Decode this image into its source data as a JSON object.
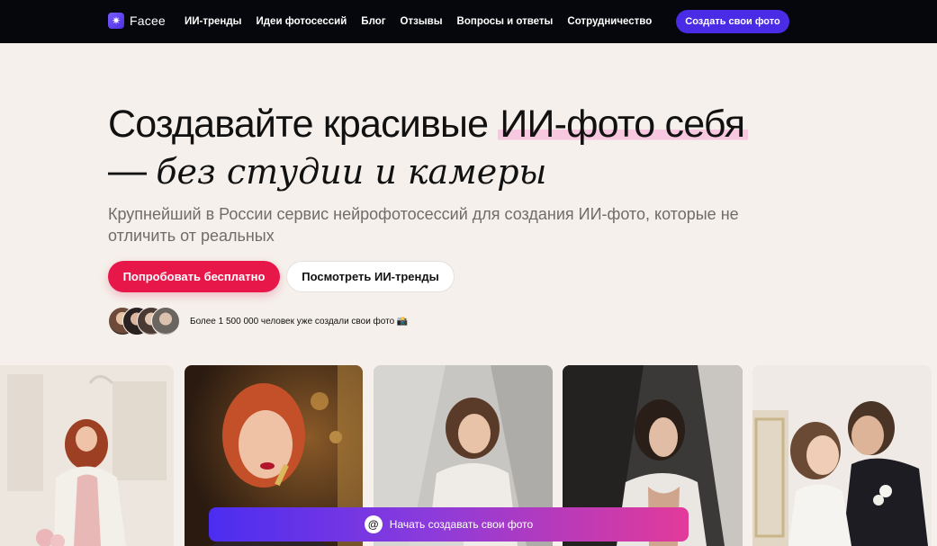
{
  "nav": {
    "logo": "Facee",
    "logo_icon": "sparkle-icon",
    "items": [
      {
        "label": "ИИ-тренды"
      },
      {
        "label": "Идеи фотосессий"
      },
      {
        "label": "Блог"
      },
      {
        "label": "Отзывы"
      },
      {
        "label": "Вопросы и ответы"
      },
      {
        "label": "Сотрудничество"
      }
    ],
    "cta": "Создать свои фото"
  },
  "hero": {
    "title_part1": "Создавайте красивые ",
    "title_highlight": "ИИ-фото себя",
    "title_dash": "— ",
    "title_italic": "без студии и камеры",
    "subtitle": "Крупнейший в России сервис нейрофотосессий для создания ИИ-фото, которые не отличить от реальных",
    "primary_button": "Попробовать бесплатно",
    "secondary_button": "Посмотреть ИИ-тренды",
    "social_proof": "Более 1 500 000 человек уже создали свои фото 📸"
  },
  "bottom_cta": {
    "label": "Начать создавать свои фото",
    "icon": "at-sign-icon"
  },
  "colors": {
    "accent_primary": "#e8174a",
    "accent_nav_button": "#4a2be6",
    "highlight": "#f7c8e0",
    "background": "#f5f0eb",
    "nav_background": "#05070d"
  }
}
